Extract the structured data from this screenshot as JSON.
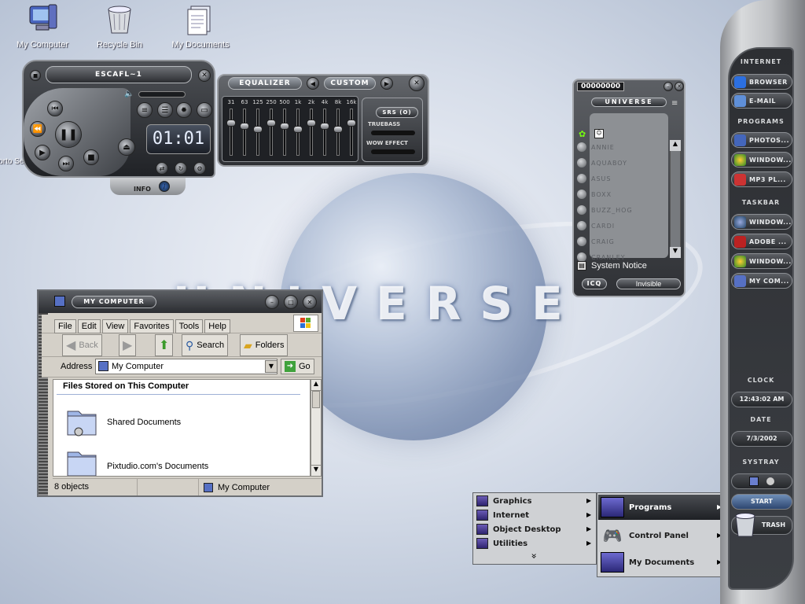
{
  "desktop": {
    "icons": [
      {
        "label": "My Computer",
        "icon": "computer-icon"
      },
      {
        "label": "Recycle Bin",
        "icon": "recycle-bin-icon"
      },
      {
        "label": "My Documents",
        "icon": "documents-icon"
      }
    ],
    "partial_label": "Norto Secu",
    "wallpaper_word": "UNIVERSE"
  },
  "player": {
    "song_title": "ESCAFL~1",
    "time": "01:01",
    "info_label": "INFO"
  },
  "equalizer": {
    "title": "EQUALIZER",
    "preset": "CUSTOM",
    "bands": [
      "31",
      "63",
      "125",
      "250",
      "500",
      "1k",
      "2k",
      "4k",
      "8k",
      "16k"
    ],
    "srs_label": "SRS (O)",
    "truebass_label": "TRUEBASS",
    "wow_label": "WOW EFFECT"
  },
  "icq": {
    "number": "00000000",
    "title": "UNIVERSE",
    "contacts": [
      "ANNIE",
      "AQUABOY",
      "ASUS",
      "BOXX",
      "BUZZ_HOG",
      "CARDI",
      "CRAIG",
      "CRANLEY"
    ],
    "system_notice": "System Notice",
    "icq_button": "ICQ",
    "status": "Invisible"
  },
  "explorer": {
    "title": "MY COMPUTER",
    "menu": [
      "File",
      "Edit",
      "View",
      "Favorites",
      "Tools",
      "Help"
    ],
    "toolbar": {
      "back": "Back",
      "search": "Search",
      "folders": "Folders"
    },
    "address_label": "Address",
    "address_value": "My Computer",
    "go_label": "Go",
    "section_heading": "Files Stored on This Computer",
    "items": [
      "Shared Documents",
      "Pixtudio.com's Documents"
    ],
    "status_count": "8 objects",
    "status_location": "My Computer"
  },
  "sidebar": {
    "internet_header": "INTERNET",
    "internet": [
      "BROWSER",
      "E-MAIL"
    ],
    "programs_header": "PROGRAMS",
    "programs": [
      "PHOTOS...",
      "WINDOW...",
      "MP3 PL..."
    ],
    "taskbar_header": "TASKBAR",
    "taskbar": [
      "WINDOW...",
      "ADOBE ...",
      "WINDOW...",
      "MY COM..."
    ],
    "clock_header": "CLOCK",
    "clock_value": "12:43:02 AM",
    "date_header": "DATE",
    "date_value": "7/3/2002",
    "systray_header": "SYSTRAY",
    "start_label": "START",
    "trash_label": "TRASH"
  },
  "start_menu": {
    "left": [
      "Graphics",
      "Internet",
      "Object Desktop",
      "Utilities"
    ],
    "more_glyph": "»",
    "right": [
      "Programs",
      "Control Panel",
      "My Documents"
    ]
  },
  "colors": {
    "accent": "#2a2c30",
    "chrome": "#bfc1c4",
    "wallpaper": "#c9d2e2"
  }
}
